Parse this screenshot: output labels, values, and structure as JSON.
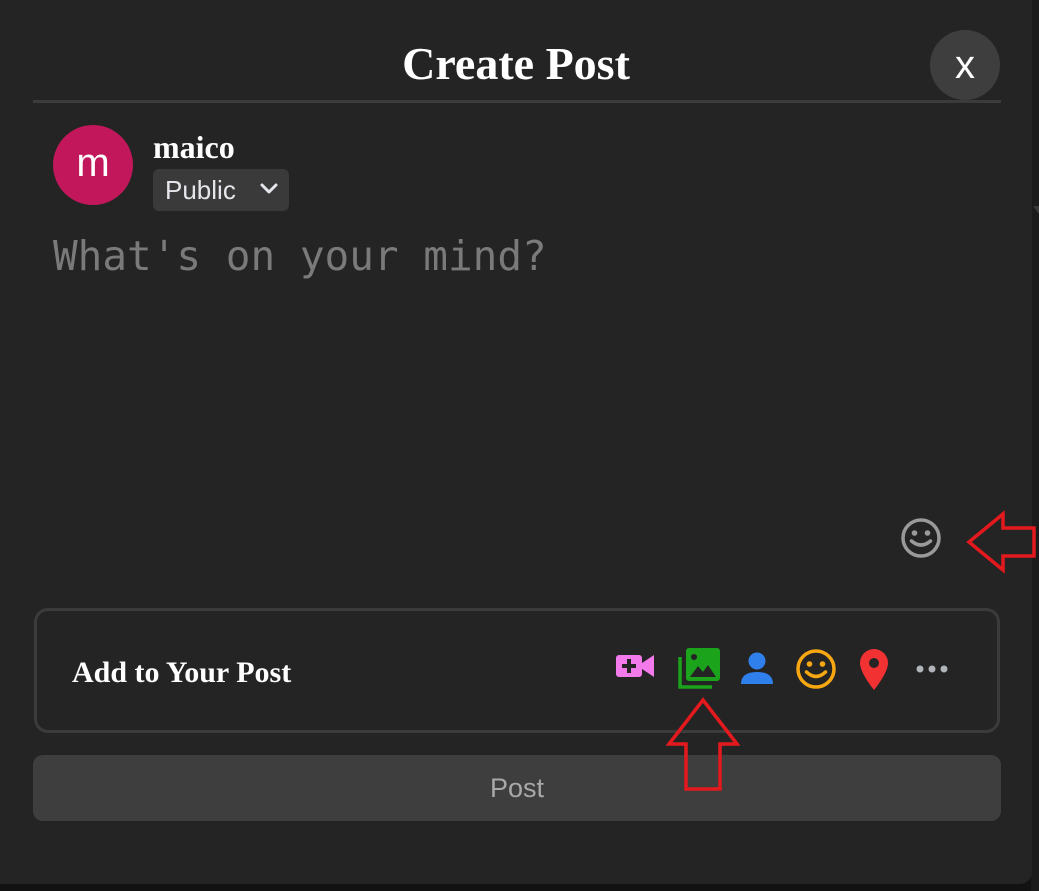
{
  "modal": {
    "title": "Create Post",
    "close_label": "x"
  },
  "user": {
    "avatar_letter": "m",
    "avatar_color": "#c2185b",
    "name": "maico",
    "privacy": "Public"
  },
  "composer": {
    "placeholder": "What's on your mind?"
  },
  "add_to_post": {
    "label": "Add to Your Post",
    "tools": [
      {
        "name": "live-video-icon",
        "color": "#f27aeb"
      },
      {
        "name": "photo-video-icon",
        "color": "#1ba31b"
      },
      {
        "name": "tag-people-icon",
        "color": "#2f80ed"
      },
      {
        "name": "feeling-activity-icon",
        "color": "#f7a711"
      },
      {
        "name": "check-in-location-icon",
        "color": "#f23232"
      },
      {
        "name": "more-options-icon",
        "color": "#b0b3b8"
      }
    ]
  },
  "post_button": {
    "label": "Post"
  },
  "annotations": {
    "arrow_color": "#e3191e"
  }
}
